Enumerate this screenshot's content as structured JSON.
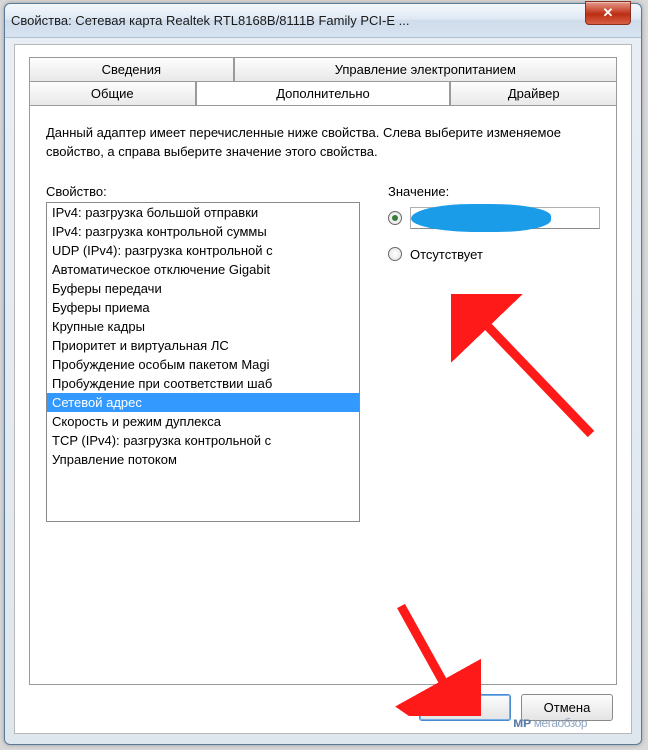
{
  "window": {
    "title": "Свойства: Сетевая карта Realtek RTL8168B/8111B Family PCI-E ..."
  },
  "tabs": {
    "row1": [
      "Сведения",
      "Управление электропитанием"
    ],
    "row2": [
      "Общие",
      "Дополнительно",
      "Драйвер"
    ],
    "active": "Дополнительно"
  },
  "description": "Данный адаптер имеет перечисленные ниже свойства. Слева выберите изменяемое свойство, а справа выберите значение этого свойства.",
  "property_label": "Свойство:",
  "value_label": "Значение:",
  "absent_label": "Отсутствует",
  "properties": [
    "IPv4: разгрузка большой отправки",
    "IPv4: разгрузка контрольной суммы",
    "UDP (IPv4): разгрузка контрольной с",
    "Автоматическое отключение Gigabit",
    "Буферы передачи",
    "Буферы приема",
    "Крупные кадры",
    "Приоритет и виртуальная ЛС",
    "Пробуждение особым пакетом Magi",
    "Пробуждение при соответствии шаб",
    "Сетевой адрес",
    "Скорость и режим дуплекса",
    "TCP (IPv4): разгрузка контрольной с",
    "Управление потоком"
  ],
  "selected_property": "Сетевой адрес",
  "radio_selected": "value",
  "buttons": {
    "ok": "ОК",
    "cancel": "Отмена"
  },
  "watermark": "мегаобзор"
}
